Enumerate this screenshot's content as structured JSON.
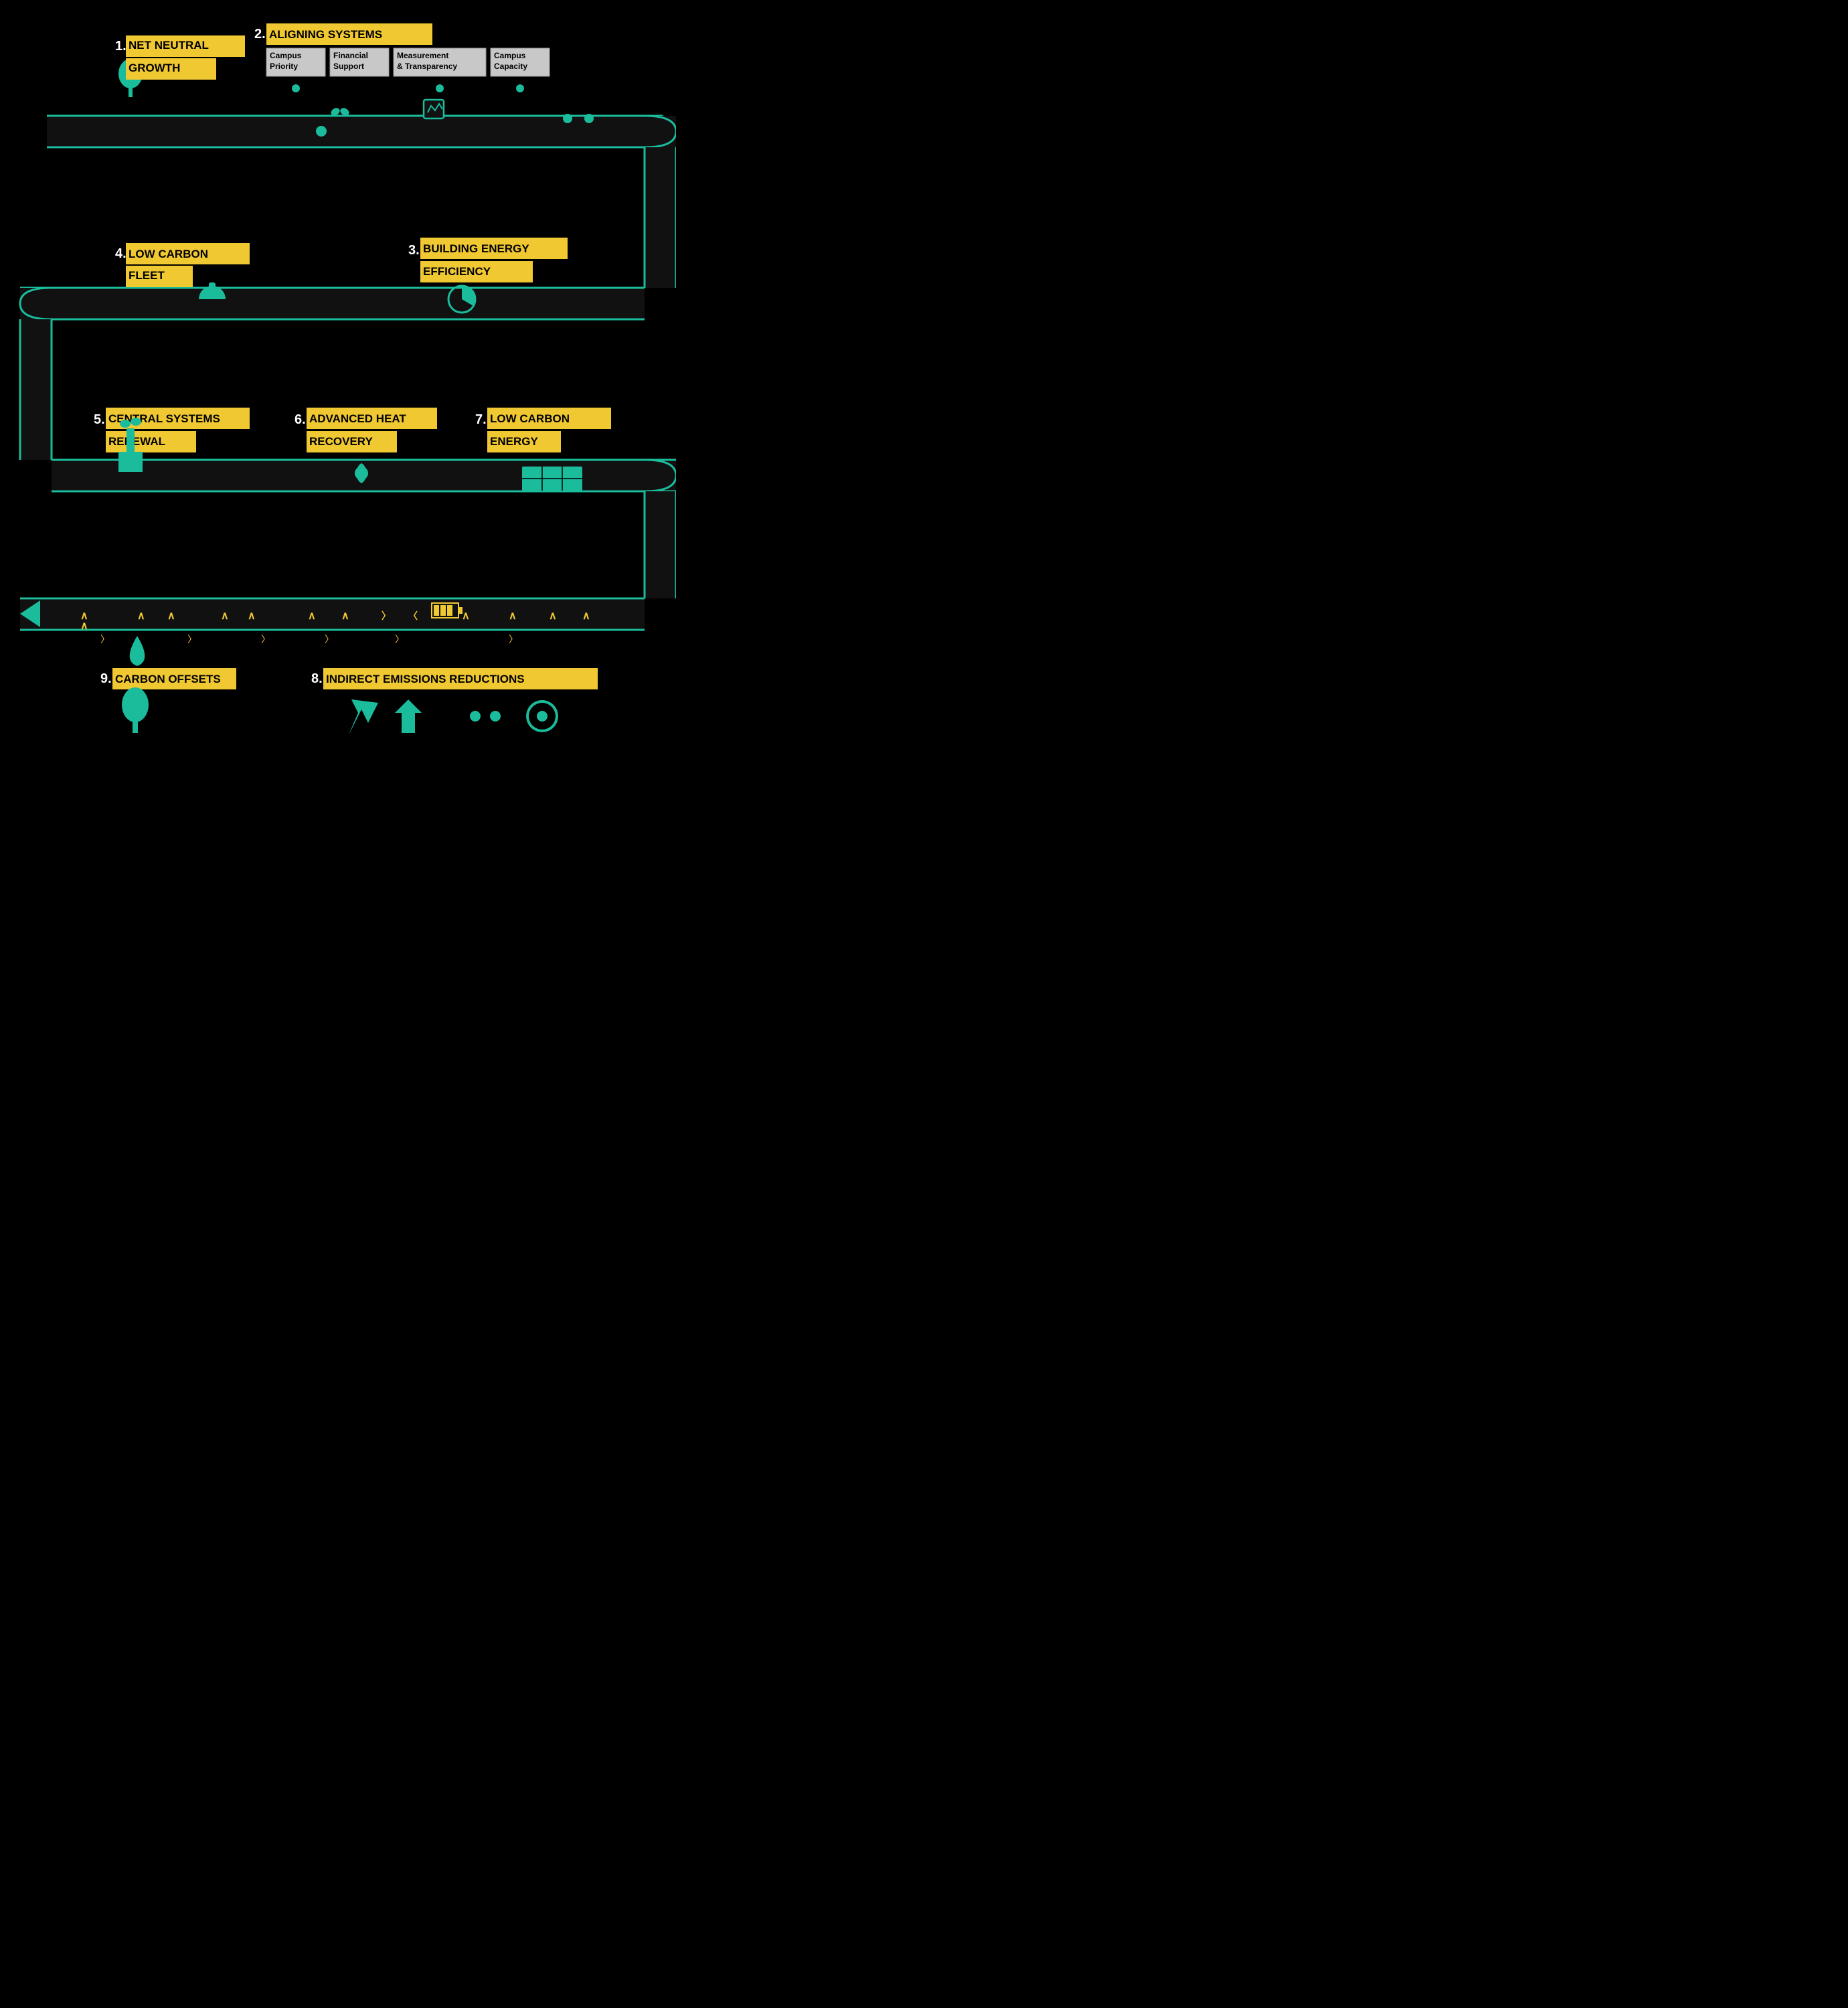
{
  "colors": {
    "teal": "#1abc9c",
    "yellow": "#f0c832",
    "bg": "#000000",
    "label_box_bg": "#c8c8c8",
    "white": "#ffffff"
  },
  "steps": {
    "s1": {
      "number": "1.",
      "label_line1": "NET NEUTRAL",
      "label_line2": "GROWTH"
    },
    "s2": {
      "number": "2.",
      "label_line1": "ALIGNING SYSTEMS"
    },
    "s2_boxes": [
      {
        "line1": "Campus",
        "line2": "Priority"
      },
      {
        "line1": "Financial",
        "line2": "Support"
      },
      {
        "line1": "Measurement",
        "line2": "& Transparency"
      },
      {
        "line1": "Campus",
        "line2": "Capacity"
      }
    ],
    "s3": {
      "number": "3.",
      "label_line1": "BUILDING ENERGY",
      "label_line2": "EFFICIENCY"
    },
    "s4": {
      "number": "4.",
      "label_line1": "LOW CARBON",
      "label_line2": "FLEET"
    },
    "s5": {
      "number": "5.",
      "label_line1": "CENTRAL SYSTEMS",
      "label_line2": "RENEWAL"
    },
    "s6": {
      "number": "6.",
      "label_line1": "ADVANCED HEAT",
      "label_line2": "RECOVERY"
    },
    "s7": {
      "number": "7.",
      "label_line1": "LOW CARBON",
      "label_line2": "ENERGY"
    },
    "s8": {
      "number": "8.",
      "label_line1": "INDIRECT EMISSIONS REDUCTIONS"
    },
    "s9": {
      "number": "9.",
      "label_line1": "CARBON OFFSETS"
    }
  }
}
